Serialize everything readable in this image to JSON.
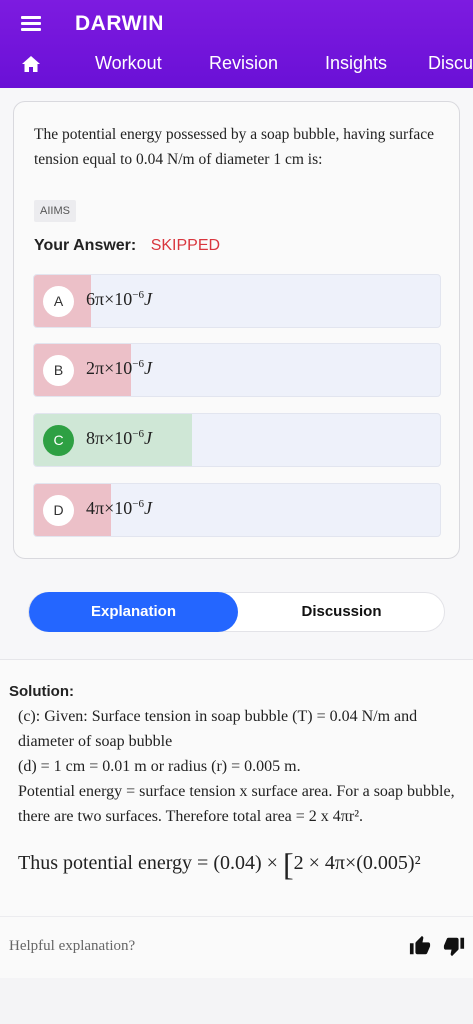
{
  "header": {
    "title": "DARWIN",
    "tabs": [
      "Workout",
      "Revision",
      "Insights",
      "Discu"
    ]
  },
  "question": {
    "text": "The potential energy possessed by a soap bubble, having surface tension equal to 0.04 N/m of diameter 1 cm is:",
    "tag": "AIIMS",
    "answer_label": "Your Answer:",
    "answer_status": "SKIPPED",
    "options": [
      {
        "letter": "A",
        "coef": "6π",
        "times": "×10",
        "exp": "−6",
        "unit": "J",
        "fill_pct": 14,
        "state": "wrong"
      },
      {
        "letter": "B",
        "coef": "2π",
        "times": "×10",
        "exp": "−6",
        "unit": "J",
        "fill_pct": 24,
        "state": "wrong"
      },
      {
        "letter": "C",
        "coef": "8π",
        "times": "×10",
        "exp": "−6",
        "unit": "J",
        "fill_pct": 39,
        "state": "correct"
      },
      {
        "letter": "D",
        "coef": "4π",
        "times": "×10",
        "exp": "−6",
        "unit": "J",
        "fill_pct": 19,
        "state": "wrong"
      }
    ]
  },
  "tabs": {
    "explanation": "Explanation",
    "discussion": "Discussion"
  },
  "solution": {
    "title": "Solution:",
    "line1": "(c): Given: Surface tension in soap bubble (T) = 0.04 N/m and diameter of soap bubble",
    "line2": "(d) = 1 cm = 0.01 m or radius (r) = 0.005 m.",
    "line3": "Potential energy = surface tension x surface area. For a soap bubble, there are two surfaces. Therefore total area = 2 x 4πr².",
    "formula_prefix": "Thus potential energy",
    "formula_body": "= (0.04) ×",
    "formula_tail": "2 × 4π×(0.005)²"
  },
  "feedback": {
    "label": "Helpful explanation?"
  },
  "colors": {
    "header": "#7d1be0",
    "wrong_fill": "#ecc0c8",
    "correct_fill": "#cfe7d6",
    "active_tab": "#2466ff",
    "skipped": "#d9363e"
  }
}
